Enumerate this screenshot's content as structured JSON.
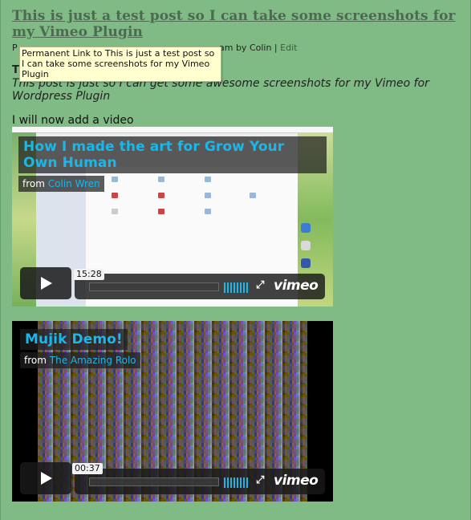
{
  "post": {
    "title": "This is just a test post so I can take some screenshots for my Vimeo Plugin",
    "meta_prefix": "P",
    "meta_author_text": "am by Colin |",
    "edit_label": "Edit",
    "tooltip": "Permanent Link to This is just a test post so I can take some screenshots for my Vimeo Plugin",
    "tags_partial": "T",
    "intro": "This post is just so I can get some awesome screenshots for my Vimeo for Wordpress Plugin",
    "add_video_text": "I will now add a video"
  },
  "videos": [
    {
      "title": "How I made the art for Grow Your Own Human",
      "from_label": "from",
      "author": "Colin Wren",
      "time": "15:28",
      "brand": "vimeo"
    },
    {
      "title": "Mujik Demo!",
      "from_label": "from",
      "author": "The Amazing Rolo",
      "time": "00:37",
      "brand": "vimeo"
    }
  ],
  "colors": {
    "page_bg": "#80bb85",
    "vimeo_blue": "#1ab7ea",
    "tooltip_bg": "#ffffcf"
  },
  "icons": [
    "play-icon",
    "volume-icon",
    "fullscreen-icon"
  ]
}
